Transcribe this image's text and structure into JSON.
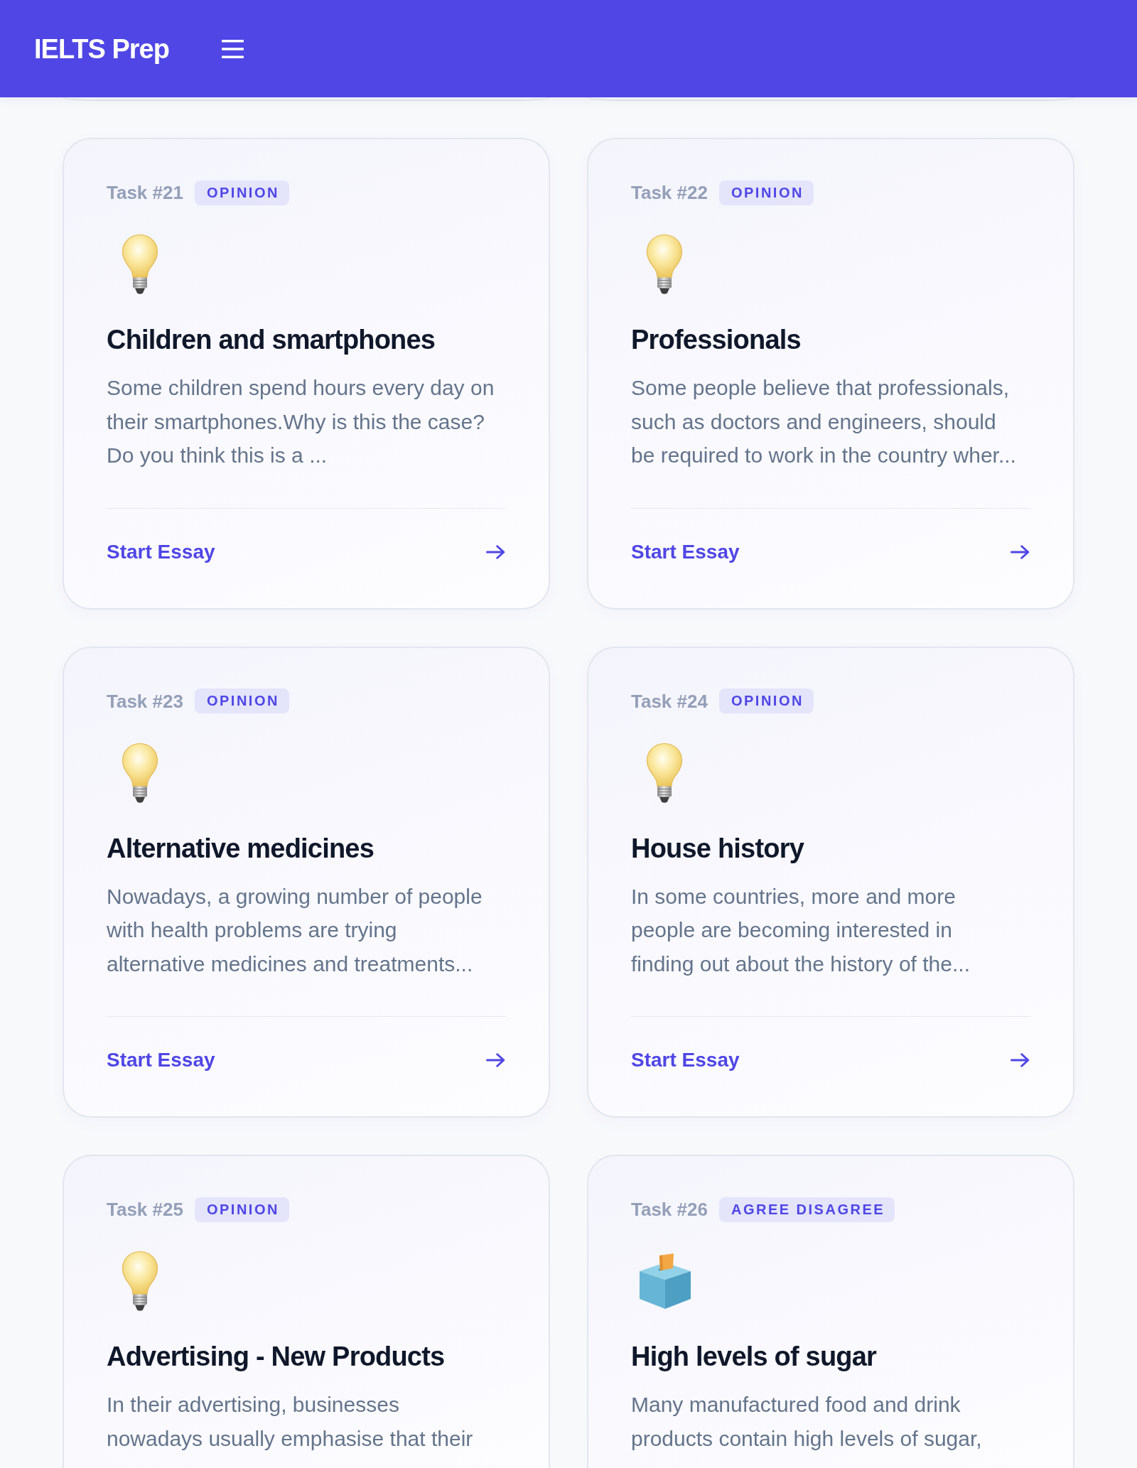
{
  "header": {
    "logo": "IELTS Prep"
  },
  "tasks": [
    {
      "kind": "opinion",
      "number": "Task #21",
      "category": "OPINION",
      "title": "Children and smartphones",
      "description": "Some children spend hours every day on\ntheir smartphones.Why is this the case?\nDo you think this is a ...",
      "action": "Start Essay"
    },
    {
      "kind": "opinion",
      "number": "Task #22",
      "category": "OPINION",
      "title": "Professionals",
      "description": "Some people believe that professionals,\nsuch as doctors and engineers, should\nbe required to work in the country wher...",
      "action": "Start Essay"
    },
    {
      "kind": "opinion",
      "number": "Task #23",
      "category": "OPINION",
      "title": "Alternative medicines",
      "description": "Nowadays, a growing number of people\nwith health problems are trying\nalternative medicines and treatments...",
      "action": "Start Essay"
    },
    {
      "kind": "opinion",
      "number": "Task #24",
      "category": "OPINION",
      "title": "House history",
      "description": "In some countries, more and more\npeople are becoming interested in\nfinding out about the history of the...",
      "action": "Start Essay"
    },
    {
      "kind": "opinion",
      "number": "Task #25",
      "category": "OPINION",
      "title": "Advertising - New Products",
      "description": "In their advertising, businesses\nnowadays usually emphasise that their"
    },
    {
      "kind": "agree_disagree",
      "number": "Task #26",
      "category": "AGREE DISAGREE",
      "title": "High levels of sugar",
      "description": "Many manufactured food and drink\nproducts contain high levels of sugar,"
    }
  ]
}
